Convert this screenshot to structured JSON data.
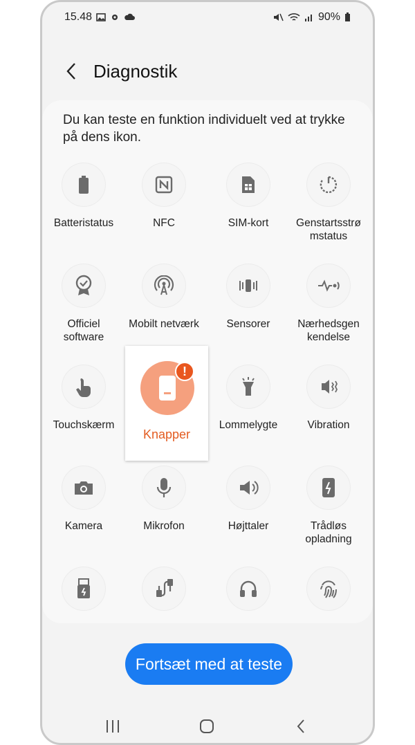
{
  "status": {
    "time": "15.48",
    "battery": "90%"
  },
  "header": {
    "title": "Diagnostik"
  },
  "description": "Du kan teste en funktion individuelt ved at trykke på dens ikon.",
  "tests": [
    {
      "label": "Batteristatus",
      "icon": "battery-icon"
    },
    {
      "label": "NFC",
      "icon": "nfc-icon"
    },
    {
      "label": "SIM-kort",
      "icon": "sim-card-icon"
    },
    {
      "label": "Genstartsstrø\nmstatus",
      "icon": "restart-icon"
    },
    {
      "label": "Officiel\nsoftware",
      "icon": "badge-icon"
    },
    {
      "label": "Mobilt netværk",
      "icon": "network-icon"
    },
    {
      "label": "Sensorer",
      "icon": "sensor-icon"
    },
    {
      "label": "Nærhedsgen\nkendelse",
      "icon": "proximity-icon"
    },
    {
      "label": "Touchskærm",
      "icon": "touch-icon"
    },
    {
      "label": "Knapper",
      "icon": "phone-buttons-icon"
    },
    {
      "label": "Lommelygte",
      "icon": "flashlight-icon"
    },
    {
      "label": "Vibration",
      "icon": "vibration-icon"
    },
    {
      "label": "Kamera",
      "icon": "camera-icon"
    },
    {
      "label": "Mikrofon",
      "icon": "microphone-icon"
    },
    {
      "label": "Højttaler",
      "icon": "speaker-icon"
    },
    {
      "label": "Trådløs\nopladning",
      "icon": "wireless-charging-icon"
    },
    {
      "label": "",
      "icon": "usb-icon"
    },
    {
      "label": "",
      "icon": "usb-cable-icon"
    },
    {
      "label": "",
      "icon": "headphones-icon"
    },
    {
      "label": "",
      "icon": "fingerprint-icon"
    }
  ],
  "highlight": {
    "label": "Knapper",
    "badge": "!"
  },
  "continue_button": "Fortsæt med at teste",
  "colors": {
    "accent": "#1a7cf2",
    "warning": "#e35c21",
    "highlight_bg": "#f5a07e"
  }
}
